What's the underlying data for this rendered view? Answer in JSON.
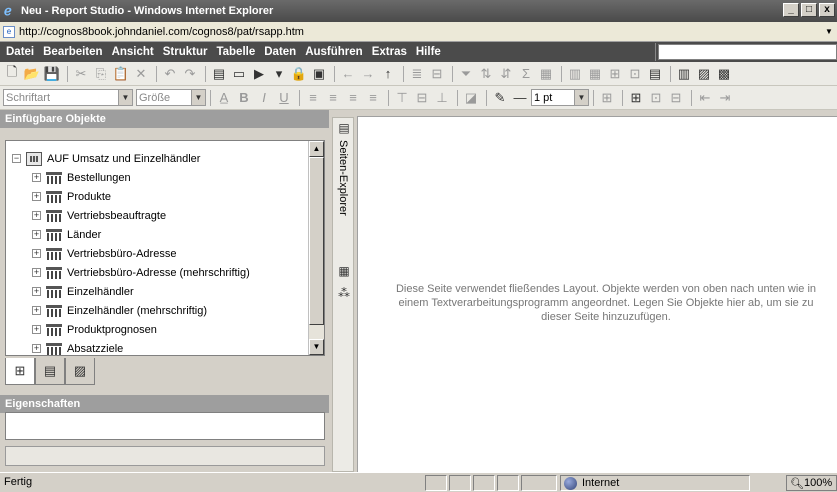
{
  "window": {
    "title": "Neu - Report Studio - Windows Internet Explorer",
    "buttons": [
      "_",
      "□",
      "x"
    ]
  },
  "address": {
    "url": "http://cognos8book.johndaniel.com/cognos8/pat/rsapp.htm"
  },
  "menu": {
    "items": [
      "Datei",
      "Bearbeiten",
      "Ansicht",
      "Struktur",
      "Tabelle",
      "Daten",
      "Ausführen",
      "Extras",
      "Hilfe"
    ]
  },
  "format": {
    "font_placeholder": "Schriftart",
    "size_placeholder": "Größe",
    "line_width": "1 pt"
  },
  "insertable": {
    "header": "Einfügbare Objekte",
    "root": "AUF Umsatz und Einzelhändler",
    "items": [
      "Bestellungen",
      "Produkte",
      "Vertriebsbeauftragte",
      "Länder",
      "Vertriebsbüro-Adresse",
      "Vertriebsbüro-Adresse (mehrschriftig)",
      "Einzelhändler",
      "Einzelhändler (mehrschriftig)",
      "Produktprognosen",
      "Absatzziele"
    ]
  },
  "properties": {
    "header": "Eigenschaften"
  },
  "explorer": {
    "label": "Seiten-Explorer"
  },
  "canvas": {
    "hint": "Diese Seite verwendet fließendes Layout. Objekte werden von oben nach unten wie in einem Textverarbeitungsprogramm angeordnet. Legen Sie Objekte hier ab, um sie zu dieser Seite hinzuzufügen."
  },
  "status": {
    "text": "Fertig",
    "zone": "Internet",
    "zoom": "100%"
  }
}
